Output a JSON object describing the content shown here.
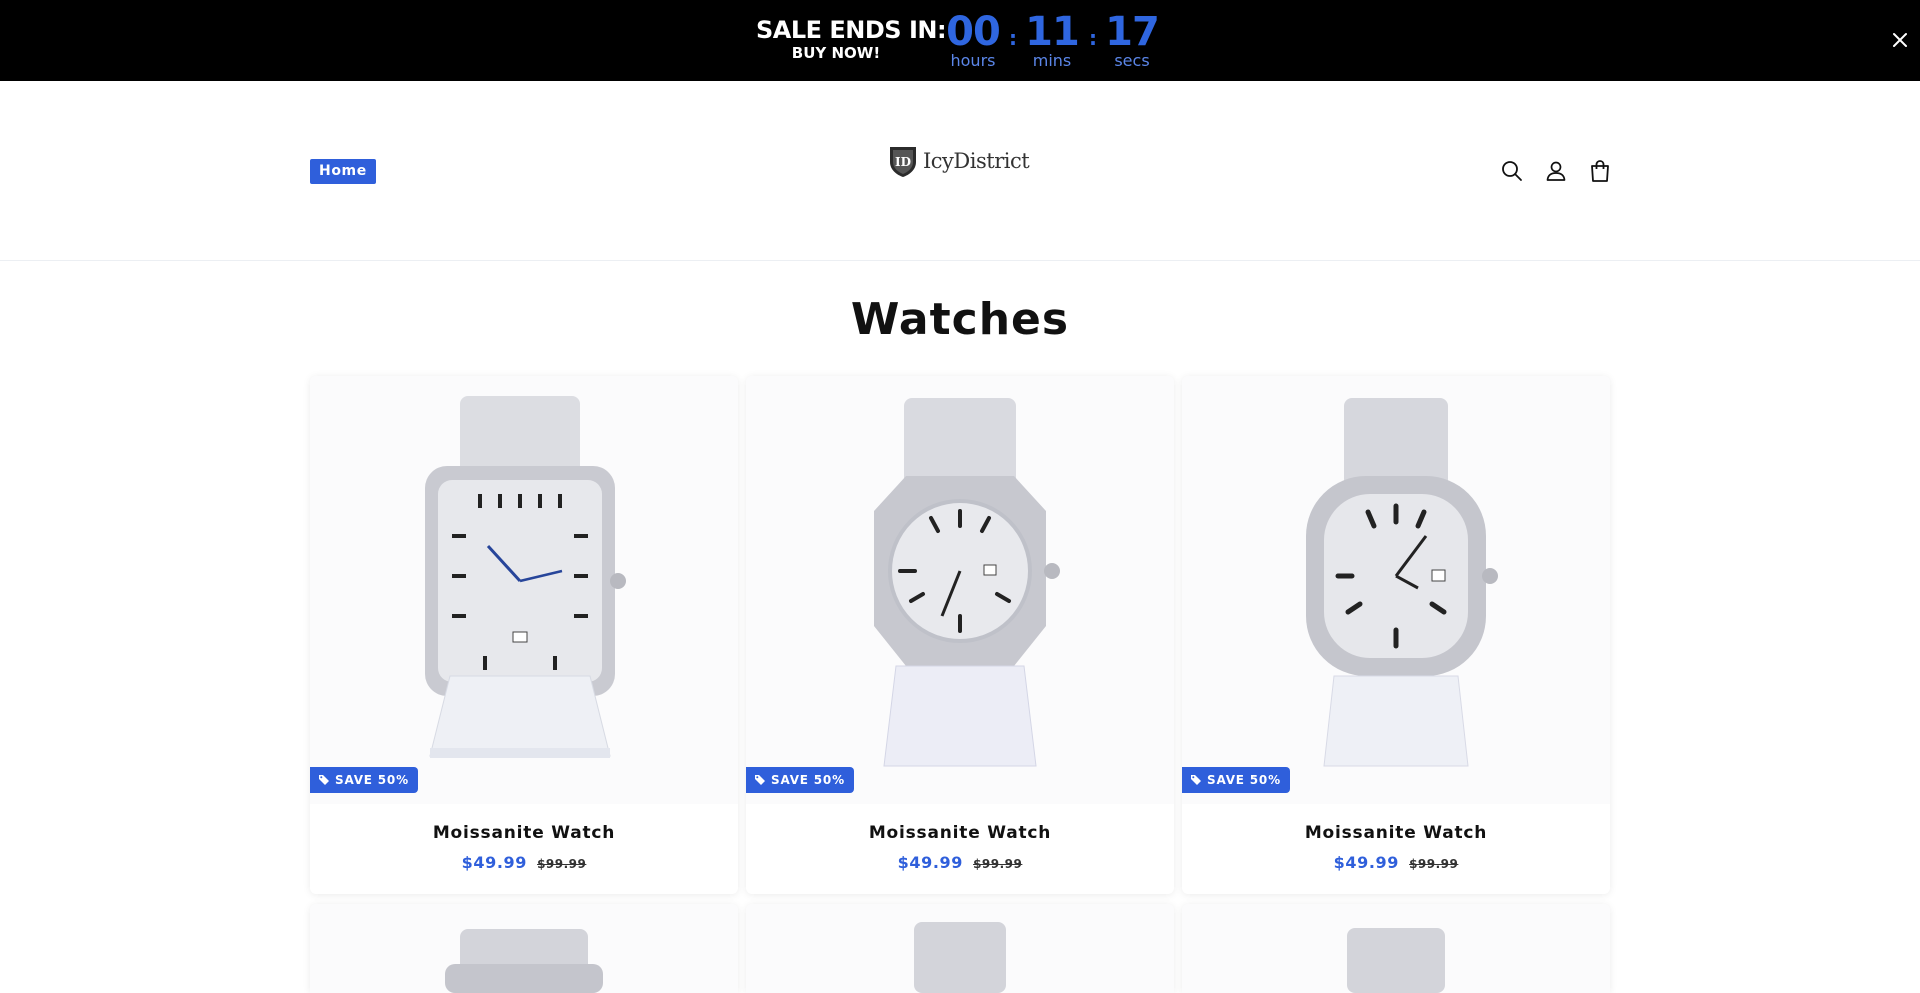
{
  "promo": {
    "title": "SALE ENDS IN:",
    "subtitle": "BUY NOW!",
    "hours": "00",
    "hours_label": "hours",
    "mins": "11",
    "mins_label": "mins",
    "secs": "17",
    "secs_label": "secs",
    "separator": ":"
  },
  "header": {
    "nav_home": "Home",
    "logo_text": "IcyDistrict",
    "logo_mark": "ID",
    "icons": [
      "search-icon",
      "account-icon",
      "cart-icon"
    ]
  },
  "collection": {
    "title": "Watches",
    "products": [
      {
        "title": "Moissanite Watch",
        "price": "$49.99",
        "compare_price": "$99.99",
        "badge": "SAVE 50%"
      },
      {
        "title": "Moissanite Watch",
        "price": "$49.99",
        "compare_price": "$99.99",
        "badge": "SAVE 50%"
      },
      {
        "title": "Moissanite Watch",
        "price": "$49.99",
        "compare_price": "$99.99",
        "badge": "SAVE 50%"
      }
    ]
  },
  "colors": {
    "accent": "#2f5fdb",
    "promo_bg": "#000000",
    "timer": "#2f66e0"
  }
}
